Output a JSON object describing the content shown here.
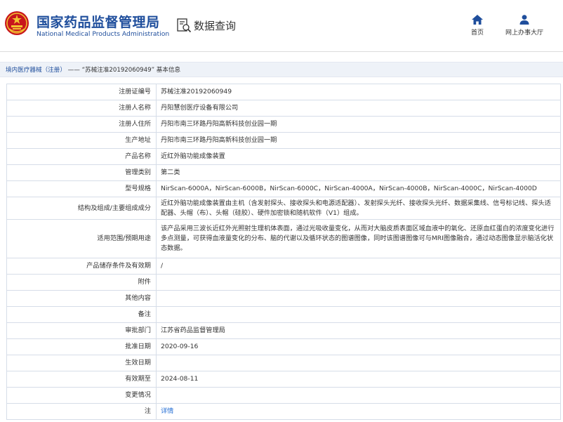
{
  "header": {
    "brand_cn": "国家药品监督管理局",
    "brand_en": "National Medical Products Administration",
    "query_label": "数据查询",
    "nav": {
      "home": "首页",
      "hall": "网上办事大厅"
    },
    "colors": {
      "brand": "#1f4e9c",
      "link": "#1f6bd3",
      "logo_red": "#c8161d",
      "logo_gold": "#f2c331"
    }
  },
  "breadcrumb": {
    "link": "境内医疗器械（注册）",
    "rest": " —— “苏械注准20192060949” 基本信息"
  },
  "fields": [
    {
      "label": "注册证编号",
      "value": "苏械注准20192060949"
    },
    {
      "label": "注册人名称",
      "value": "丹阳慧创医疗设备有限公司"
    },
    {
      "label": "注册人住所",
      "value": "丹阳市南三环路丹阳高新科技创业园一期"
    },
    {
      "label": "生产地址",
      "value": "丹阳市南三环路丹阳高新科技创业园一期"
    },
    {
      "label": "产品名称",
      "value": "近红外脑功能成像装置"
    },
    {
      "label": "管理类别",
      "value": "第二类"
    },
    {
      "label": "型号规格",
      "value": "NirScan-6000A，NirScan-6000B，NirScan-6000C，NirScan-4000A，NirScan-4000B，NirScan-4000C，NirScan-4000D"
    },
    {
      "label": "结构及组成/主要组成成分",
      "value": "近红外脑功能成像装置由主机（含发射探头、接收探头和电源适配器）、发射探头光纤、接收探头光纤、数据采集线、信号标记线、探头适配器、头帽（布）、头帽（硅胶）、硬件加密锁和随机软件（V1）组成。"
    },
    {
      "label": "适用范围/预期用途",
      "value": "该产品采用三波长近红外光照射生理机体表面，通过光吸收量变化，从而对大脑皮质表面区域血液中的氧化、还原血红蛋白的浓度变化进行多点测量，可获得血液量变化的分布、脑的代谢以及循环状态的图谱图像，同时该图谱图像可与MRI图像融合，通过动态图像显示脑活化状态数据。"
    },
    {
      "label": "产品储存条件及有效期",
      "value": "/"
    },
    {
      "label": "附件",
      "value": ""
    },
    {
      "label": "其他内容",
      "value": ""
    },
    {
      "label": "备注",
      "value": ""
    },
    {
      "label": "审批部门",
      "value": "江苏省药品监督管理局"
    },
    {
      "label": "批准日期",
      "value": "2020-09-16"
    },
    {
      "label": "生效日期",
      "value": ""
    },
    {
      "label": "有效期至",
      "value": "2024-08-11"
    },
    {
      "label": "变更情况",
      "value": ""
    },
    {
      "label": "注",
      "value": "详情"
    }
  ]
}
